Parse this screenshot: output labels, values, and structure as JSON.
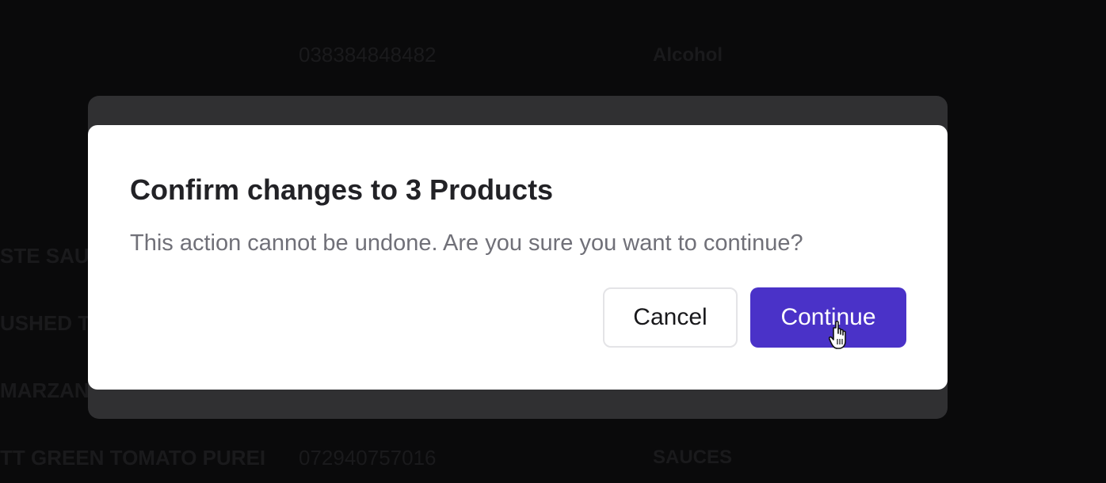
{
  "background_table": {
    "row1": {
      "barcode": "038384848482",
      "category": "Alcohol"
    },
    "row2": {
      "name": "STE SAU"
    },
    "row3": {
      "name": "USHED T"
    },
    "row4": {
      "name": "MARZAN"
    },
    "row5": {
      "name": "TT GREEN TOMATO PUREI",
      "barcode": "072940757016",
      "category": "SAUCES"
    }
  },
  "dialog": {
    "title": "Confirm changes to 3 Products",
    "description": "This action cannot be undone. Are you sure you want to continue?",
    "cancel_label": "Cancel",
    "continue_label": "Continue"
  },
  "colors": {
    "primary": "#4a32c8",
    "overlay": "#0a0a0b",
    "backsheet": "#303032"
  },
  "icons": {
    "cursor": "hand-pointer-icon"
  }
}
